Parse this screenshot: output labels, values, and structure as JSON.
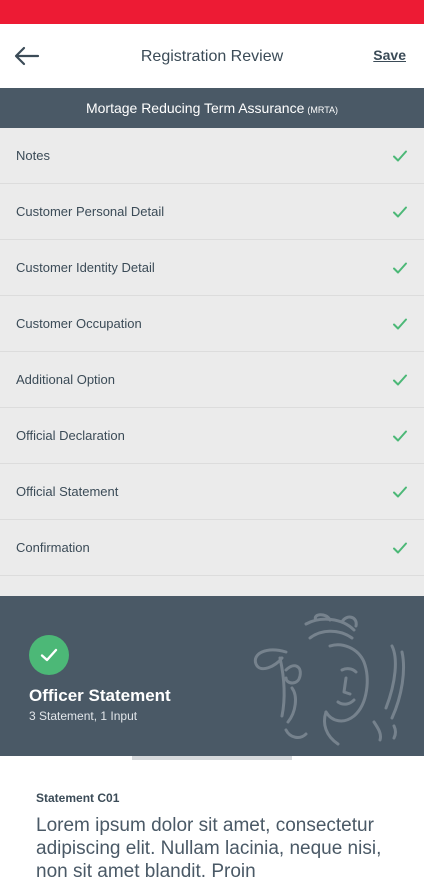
{
  "app_bar": {
    "title": "Registration Review",
    "save_label": "Save",
    "back_icon": "arrow-left-icon"
  },
  "product": {
    "name": "Mortage Reducing Term Assurance",
    "abbreviation": "(MRTA)"
  },
  "checklist": [
    {
      "label": "Notes",
      "status": "complete"
    },
    {
      "label": "Customer Personal Detail",
      "status": "complete"
    },
    {
      "label": "Customer Identity Detail",
      "status": "complete"
    },
    {
      "label": "Customer Occupation",
      "status": "complete"
    },
    {
      "label": "Additional Option",
      "status": "complete"
    },
    {
      "label": "Official Declaration",
      "status": "complete"
    },
    {
      "label": "Official Statement",
      "status": "complete"
    },
    {
      "label": "Confirmation",
      "status": "complete"
    }
  ],
  "officer_section": {
    "title": "Officer Statement",
    "subtitle": "3 Statement, 1 Input",
    "status_icon": "check-circle-icon",
    "emblem_icon": "brand-emblem-icon"
  },
  "statement_card": {
    "label": "Statement C01",
    "body": "Lorem ipsum dolor sit amet, consectetur adipiscing elit. Nullam lacinia, neque nisi, non sit amet blandit. Proin"
  },
  "colors": {
    "brand_red": "#ed1b34",
    "header_slate": "#4a5966",
    "check_green": "#4cb877",
    "list_background": "#ebebeb",
    "text_dark": "#3b4b57"
  }
}
